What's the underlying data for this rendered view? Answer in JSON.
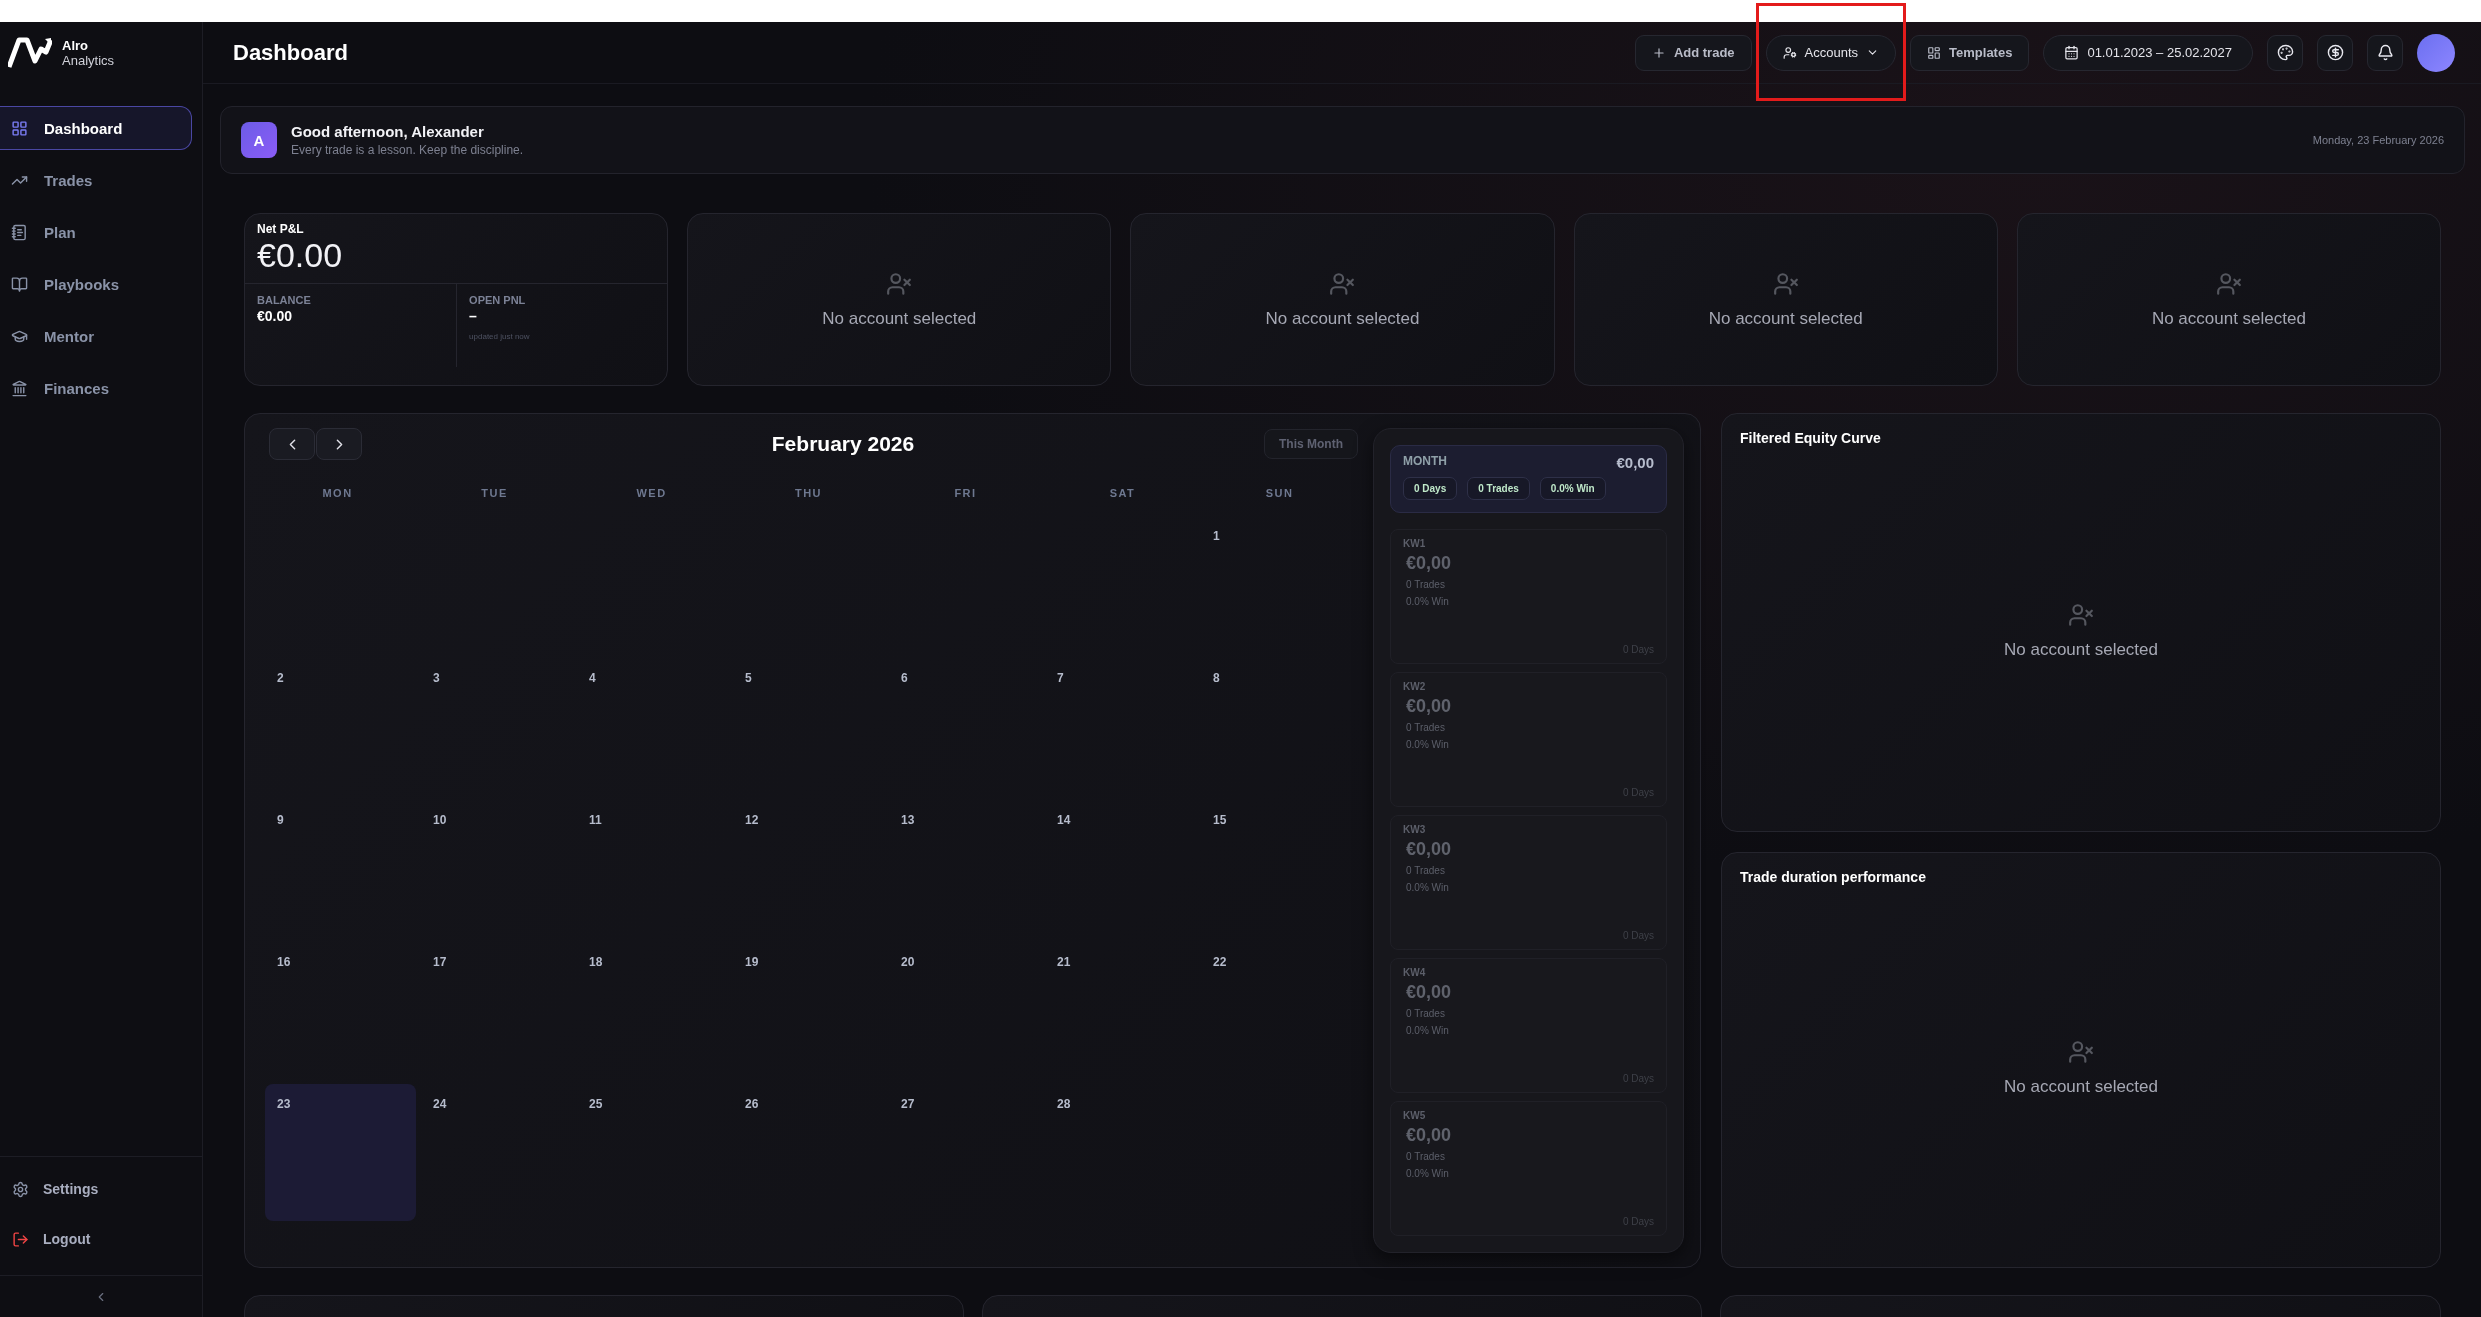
{
  "sidebar": {
    "brand_name": "Alro",
    "brand_sub": "Analytics",
    "items": [
      {
        "label": "Dashboard",
        "selected": true
      },
      {
        "label": "Trades",
        "selected": false
      },
      {
        "label": "Plan",
        "selected": false
      },
      {
        "label": "Playbooks",
        "selected": false
      },
      {
        "label": "Mentor",
        "selected": false
      },
      {
        "label": "Finances",
        "selected": false
      }
    ],
    "footer": [
      {
        "label": "Settings",
        "kind": "normal"
      },
      {
        "label": "Logout",
        "kind": "danger"
      }
    ]
  },
  "header": {
    "title": "Dashboard",
    "actions": [
      {
        "kind": "button",
        "label": "Add trade",
        "highlighted": false
      },
      {
        "kind": "dropdown",
        "label": "Accounts",
        "highlighted": true
      },
      {
        "kind": "button",
        "label": "Templates",
        "highlighted": false
      },
      {
        "kind": "range",
        "label": "01.01.2023 – 25.02.2027",
        "highlighted": false
      },
      {
        "kind": "icon",
        "highlighted": false
      },
      {
        "kind": "icon",
        "highlighted": false
      },
      {
        "kind": "icon",
        "highlighted": false
      },
      {
        "kind": "avatar",
        "highlighted": false
      }
    ]
  },
  "greeting": {
    "initial": "A",
    "title": "Good afternoon, Alexander",
    "subtitle": "Every trade is a lesson. Keep the discipline.",
    "date": "Monday, 23 February 2026"
  },
  "net_pnl": {
    "label": "Net P&L",
    "value": "€0.00",
    "balance_label": "BALANCE",
    "balance": "€0.00",
    "open_label": "OPEN PNL",
    "open_value": "–",
    "updated": "updated just now"
  },
  "account_cards": [
    {
      "message": "No account selected"
    },
    {
      "message": "No account selected"
    },
    {
      "message": "No account selected"
    },
    {
      "message": "No account selected"
    }
  ],
  "calendar": {
    "title": "February 2026",
    "this_month": "This Month",
    "weekdays": [
      "MON",
      "TUE",
      "WED",
      "THU",
      "FRI",
      "SAT",
      "SUN"
    ],
    "weeks": [
      {
        "days": [
          {
            "label": "1",
            "today": false
          }
        ]
      },
      {
        "days": [
          {
            "label": "2",
            "today": false
          },
          {
            "label": "3",
            "today": false
          },
          {
            "label": "4",
            "today": false
          },
          {
            "label": "5",
            "today": false
          },
          {
            "label": "6",
            "today": false
          },
          {
            "label": "7",
            "today": false
          },
          {
            "label": "8",
            "today": false
          }
        ]
      },
      {
        "days": [
          {
            "label": "9",
            "today": false
          },
          {
            "label": "10",
            "today": false
          },
          {
            "label": "11",
            "today": false
          },
          {
            "label": "12",
            "today": false
          },
          {
            "label": "13",
            "today": false
          },
          {
            "label": "14",
            "today": false
          },
          {
            "label": "15",
            "today": false
          }
        ]
      },
      {
        "days": [
          {
            "label": "16",
            "today": false
          },
          {
            "label": "17",
            "today": false
          },
          {
            "label": "18",
            "today": false
          },
          {
            "label": "19",
            "today": false
          },
          {
            "label": "20",
            "today": false
          },
          {
            "label": "21",
            "today": false
          },
          {
            "label": "22",
            "today": false
          }
        ]
      },
      {
        "days": [
          {
            "label": "23",
            "today": true
          },
          {
            "label": "24",
            "today": false
          },
          {
            "label": "25",
            "today": false
          },
          {
            "label": "26",
            "today": false
          },
          {
            "label": "27",
            "today": false
          },
          {
            "label": "28",
            "today": false
          }
        ]
      }
    ],
    "month": {
      "label": "MONTH",
      "value": "€0,00",
      "chips": [
        "0 Days",
        "0 Trades",
        "0.0% Win"
      ]
    },
    "week_summaries": [
      {
        "label": "KW1",
        "value": "€0,00",
        "trades": "0 Trades",
        "win": "0.0% Win",
        "days": "0 Days"
      },
      {
        "label": "KW2",
        "value": "€0,00",
        "trades": "0 Trades",
        "win": "0.0% Win",
        "days": "0 Days"
      },
      {
        "label": "KW3",
        "value": "€0,00",
        "trades": "0 Trades",
        "win": "0.0% Win",
        "days": "0 Days"
      },
      {
        "label": "KW4",
        "value": "€0,00",
        "trades": "0 Trades",
        "win": "0.0% Win",
        "days": "0 Days"
      },
      {
        "label": "KW5",
        "value": "€0,00",
        "trades": "0 Trades",
        "win": "0.0% Win",
        "days": "0 Days"
      }
    ]
  },
  "panels": [
    {
      "title": "Filtered Equity Curve",
      "message": "No account selected"
    },
    {
      "title": "Trade duration performance",
      "message": "No account selected"
    }
  ]
}
